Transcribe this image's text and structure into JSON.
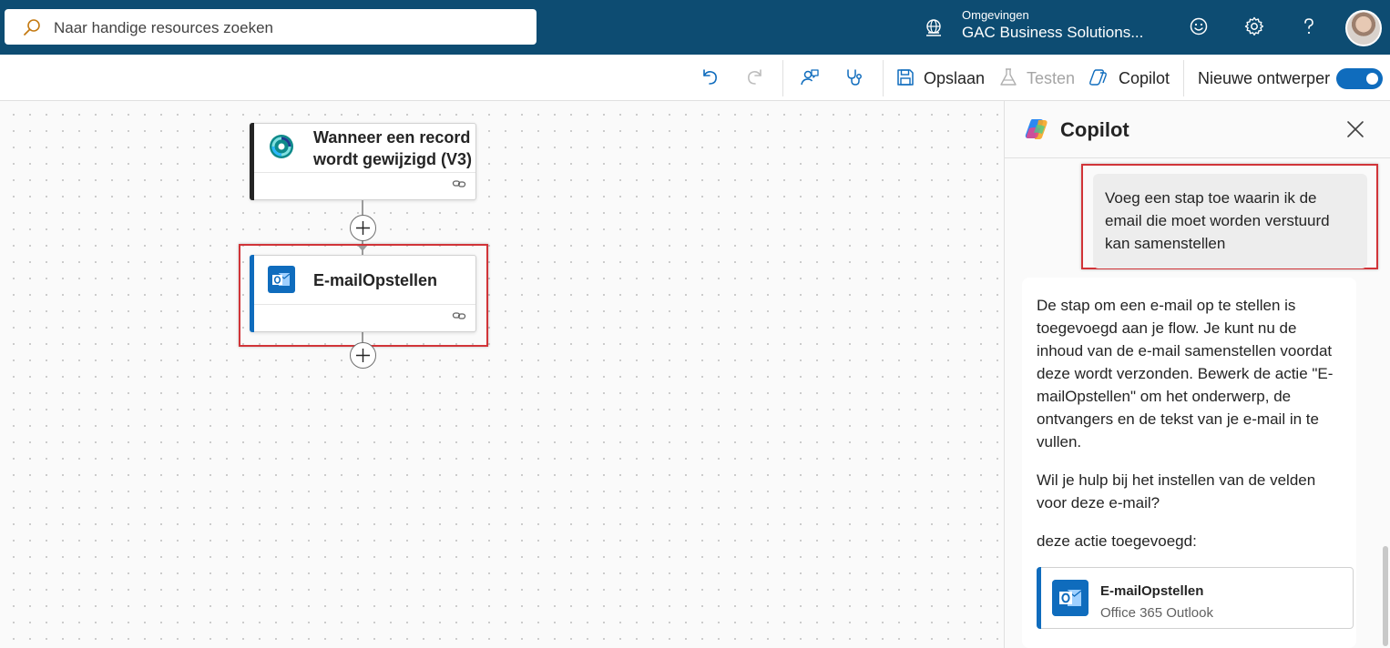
{
  "topbar": {
    "search_placeholder": "Naar handige resources zoeken",
    "environment_label": "Omgevingen",
    "environment_name": "GAC Business Solutions..."
  },
  "commandbar": {
    "save_label": "Opslaan",
    "test_label": "Testen",
    "copilot_label": "Copilot",
    "new_designer_label": "Nieuwe ontwerper",
    "new_designer_on": true
  },
  "canvas": {
    "trigger_title_line1": "Wanneer een record",
    "trigger_title_line2": "wordt gewijzigd (V3)",
    "action_title": "E-mailOpstellen"
  },
  "copilot": {
    "title": "Copilot",
    "user_message": "Voeg een stap toe waarin ik de email die moet worden verstuurd kan samenstellen",
    "bot_paragraph_1": "De stap om een e-mail op te stellen is toegevoegd aan je flow. Je kunt nu de inhoud van de e-mail samenstellen voordat deze wordt verzonden. Bewerk de actie \"E-mailOpstellen\" om het onderwerp, de ontvangers en de tekst van je e-mail in te vullen.",
    "bot_paragraph_2": "Wil je hulp bij het instellen van de velden voor deze e-mail?",
    "bot_paragraph_3": "deze actie toegevoegd:",
    "card_title": "E-mailOpstellen",
    "card_subtitle": "Office 365 Outlook"
  },
  "colors": {
    "topbar": "#0d4c72",
    "accent": "#0f6cbd",
    "highlight": "#d13438",
    "trigger_stripe": "#242424"
  }
}
